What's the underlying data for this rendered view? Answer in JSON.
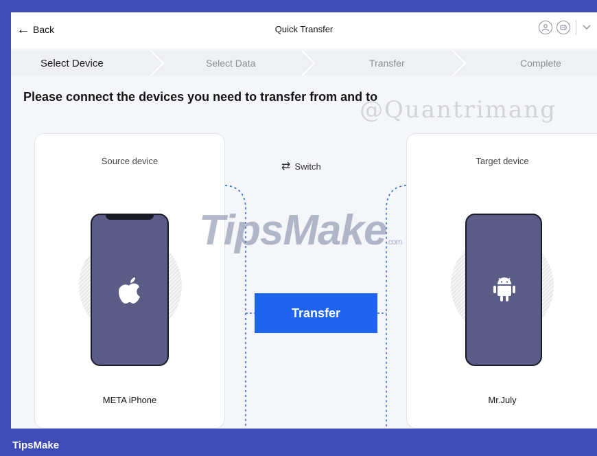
{
  "header": {
    "back_label": "Back",
    "title": "Quick Transfer"
  },
  "steps": [
    {
      "label": "Select Device",
      "active": true
    },
    {
      "label": "Select Data",
      "active": false
    },
    {
      "label": "Transfer",
      "active": false
    },
    {
      "label": "Complete",
      "active": false
    }
  ],
  "main": {
    "headline": "Please connect the devices you need to transfer from and to",
    "switch_label": "Switch",
    "transfer_label": "Transfer"
  },
  "source": {
    "label": "Source device",
    "device_name": "META iPhone",
    "icon": "apple-icon"
  },
  "target": {
    "label": "Target device",
    "device_name": "Mr.July",
    "icon": "android-icon"
  },
  "watermarks": {
    "top": "@Quantrimang",
    "mid": "TipsMake",
    "mid_suffix": ".com"
  },
  "footer": {
    "brand": "TipsMake"
  },
  "colors": {
    "frame": "#3f4cb5",
    "accent": "#1f64f0",
    "phone": "#5a5c86",
    "connector": "#2f6fe0"
  }
}
